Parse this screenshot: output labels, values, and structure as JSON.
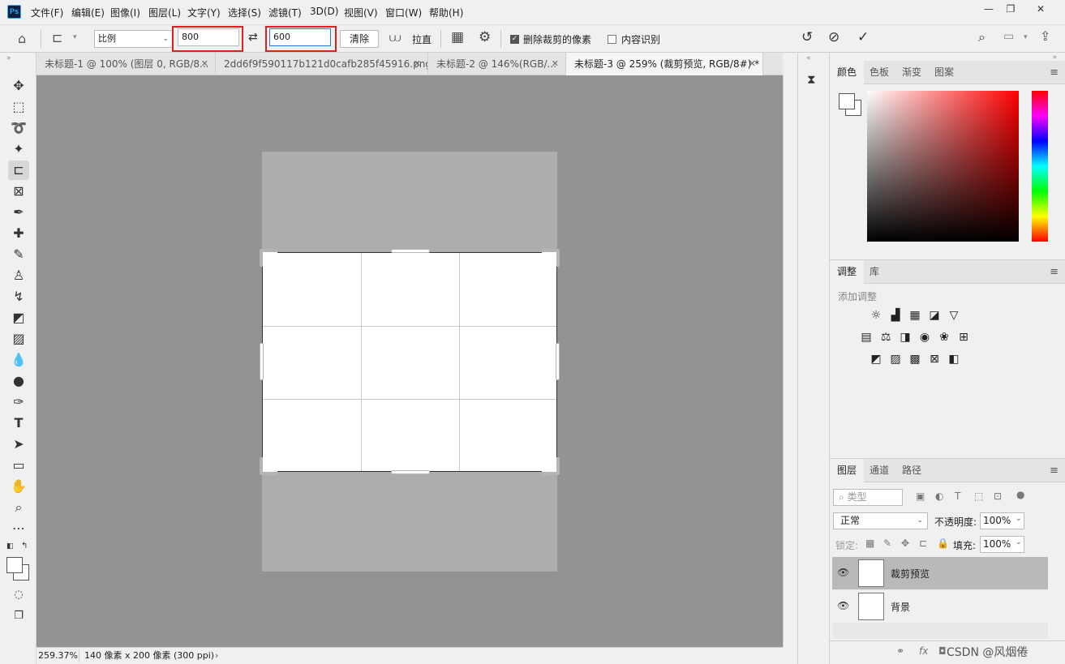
{
  "app": {
    "logo": "Ps"
  },
  "menu": [
    "文件(F)",
    "编辑(E)",
    "图像(I)",
    "图层(L)",
    "文字(Y)",
    "选择(S)",
    "滤镜(T)",
    "3D(D)",
    "视图(V)",
    "窗口(W)",
    "帮助(H)"
  ],
  "window_controls": {
    "minimize_icon": "minimize-icon",
    "restore_icon": "restore-icon",
    "close_icon": "close-icon"
  },
  "options": {
    "ratio_select": "比例",
    "width_value": "800",
    "height_value": "600",
    "swap_icon": "⇄",
    "clear_button": "清除",
    "straighten_label": "拉直",
    "delete_cropped": {
      "label": "删除裁剪的像素",
      "checked": true
    },
    "content_aware": {
      "label": "内容识别",
      "checked": false
    }
  },
  "tabs": [
    {
      "label": "未标题-1 @ 100% (图层 0, RGB/8...",
      "active": false
    },
    {
      "label": "2dd6f9f590117b121d0cafb285f45916.png",
      "active": false
    },
    {
      "label": "未标题-2 @ 146%(RGB/...",
      "active": false
    },
    {
      "label": "未标题-3 @ 259% (裁剪预览, RGB/8#) *",
      "active": true
    }
  ],
  "status": {
    "zoom": "259.37%",
    "doc_info": "140 像素 x 200 像素 (300 ppi)"
  },
  "color_panel": {
    "tabs": [
      "颜色",
      "色板",
      "渐变",
      "图案"
    ],
    "active": "颜色",
    "accent": "#ff0000"
  },
  "adjust_panel": {
    "tabs": [
      "调整",
      "库"
    ],
    "active": "调整",
    "add_label": "添加调整"
  },
  "layers_panel": {
    "tabs": [
      "图层",
      "通道",
      "路径"
    ],
    "active": "图层",
    "filter_placeholder": "类型",
    "blend_mode": "正常",
    "opacity_label": "不透明度:",
    "opacity_value": "100%",
    "lock_label": "锁定:",
    "fill_label": "填充:",
    "fill_value": "100%",
    "layers": [
      {
        "name": "裁剪预览",
        "selected": true
      },
      {
        "name": "背景",
        "selected": false
      }
    ]
  },
  "watermark": "CSDN @风烟倦"
}
